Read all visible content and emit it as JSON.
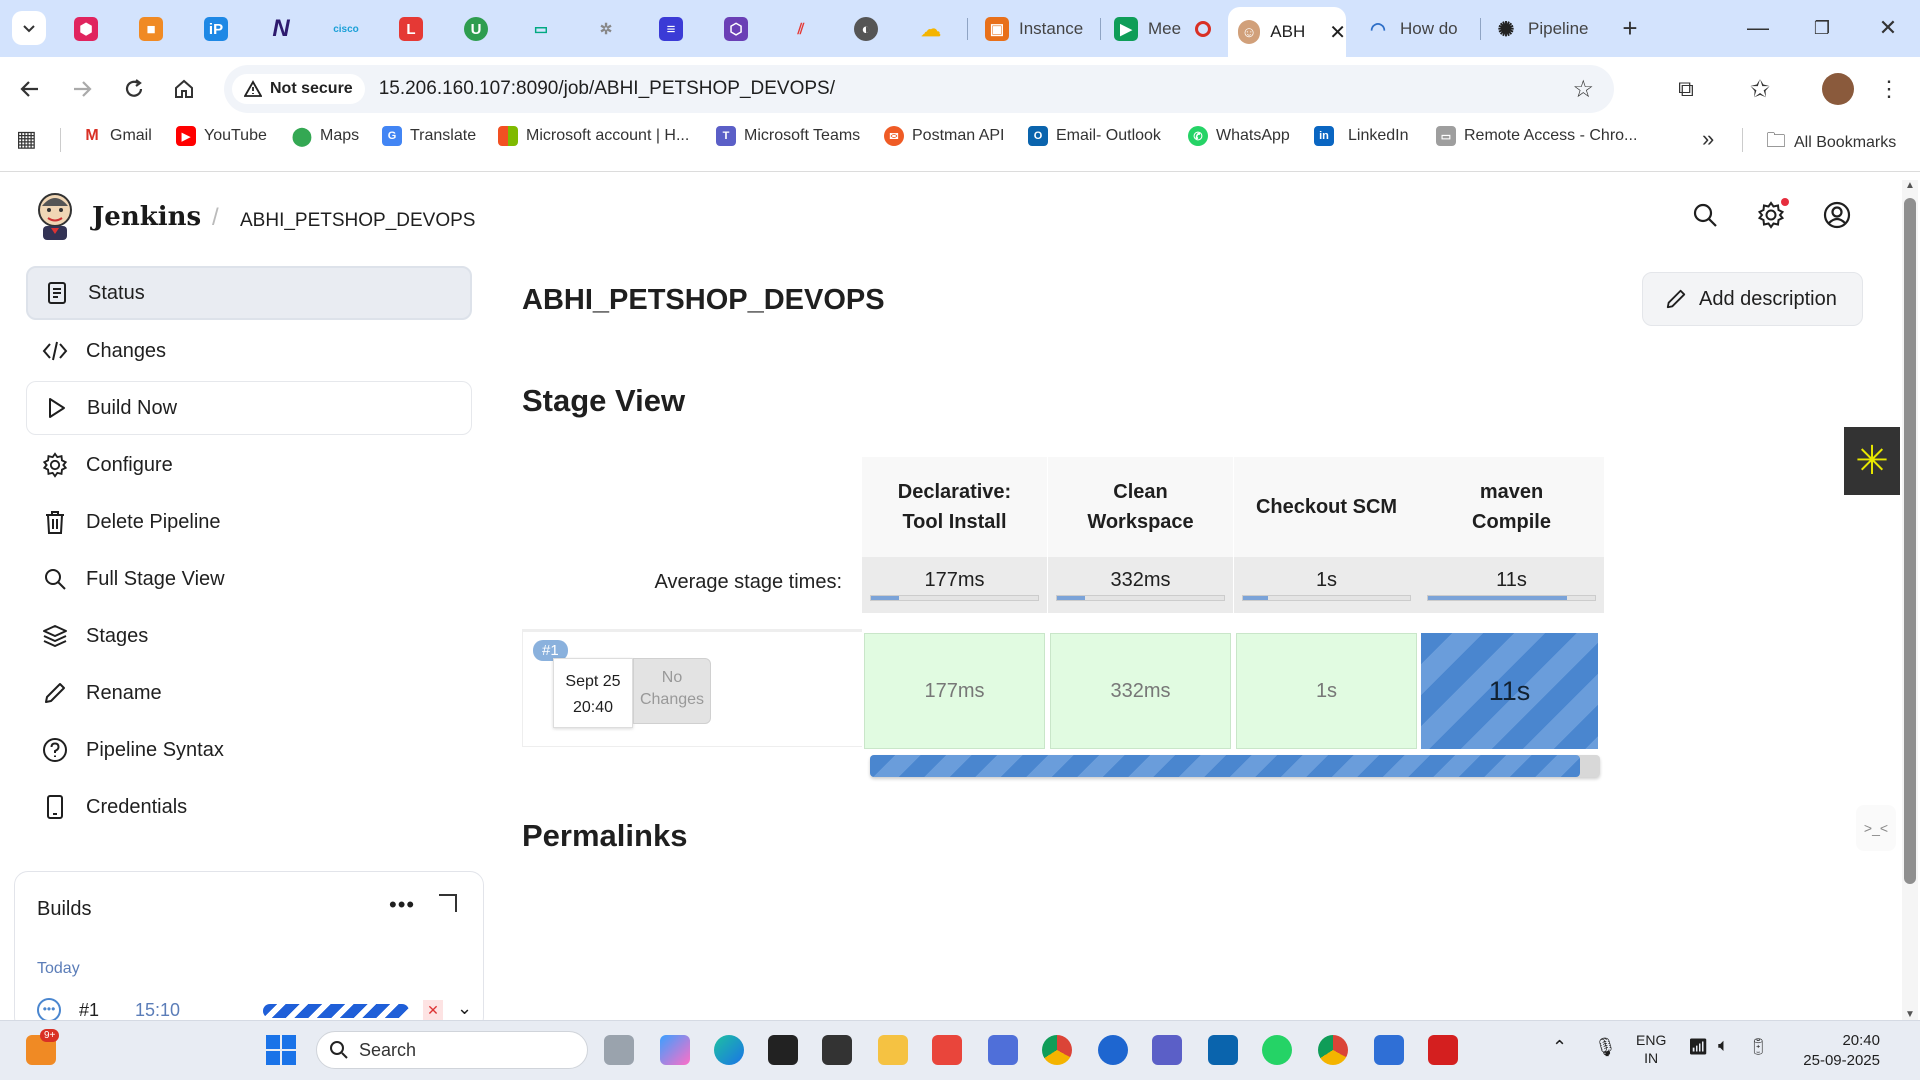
{
  "browser": {
    "tabs": [
      {
        "label": "Instance",
        "icon": "aws-icon"
      },
      {
        "label": "Mee",
        "icon": "meet-icon"
      },
      {
        "label": "ABH",
        "icon": "jenkins-icon"
      },
      {
        "label": "How do",
        "icon": "perplexity-icon"
      },
      {
        "label": "Pipeline",
        "icon": "chatgpt-icon"
      }
    ],
    "security_label": "Not secure",
    "url": "15.206.160.107:8090/job/ABHI_PETSHOP_DEVOPS/",
    "bookmarks": [
      "Gmail",
      "YouTube",
      "Maps",
      "Translate",
      "Microsoft account | H...",
      "Microsoft Teams",
      "Postman API",
      "Email- Outlook",
      "WhatsApp",
      "LinkedIn",
      "Remote Access - Chro..."
    ],
    "all_bookmarks": "All Bookmarks"
  },
  "jenkins": {
    "brand": "Jenkins",
    "breadcrumb": "ABHI_PETSHOP_DEVOPS",
    "sidebar": [
      {
        "label": "Status",
        "icon": "document-icon"
      },
      {
        "label": "Changes",
        "icon": "code-icon"
      },
      {
        "label": "Build Now",
        "icon": "play-icon"
      },
      {
        "label": "Configure",
        "icon": "gear-icon"
      },
      {
        "label": "Delete Pipeline",
        "icon": "trash-icon"
      },
      {
        "label": "Full Stage View",
        "icon": "search-icon"
      },
      {
        "label": "Stages",
        "icon": "layers-icon"
      },
      {
        "label": "Rename",
        "icon": "pencil-icon"
      },
      {
        "label": "Pipeline Syntax",
        "icon": "help-icon"
      },
      {
        "label": "Credentials",
        "icon": "phone-icon"
      }
    ],
    "builds": {
      "title": "Builds",
      "group": "Today",
      "items": [
        {
          "number": "#1",
          "time": "15:10"
        }
      ]
    },
    "title": "ABHI_PETSHOP_DEVOPS",
    "add_description": "Add description",
    "stage_view_title": "Stage View",
    "permalinks_title": "Permalinks",
    "stage_view": {
      "avg_label": "Average stage times:",
      "stages": [
        {
          "name_line1": "Declarative:",
          "name_line2": "Tool Install",
          "avg": "177ms",
          "avg_fraction": 0.17,
          "run": "177ms",
          "state": "success"
        },
        {
          "name_line1": "Clean",
          "name_line2": "Workspace",
          "avg": "332ms",
          "avg_fraction": 0.17,
          "run": "332ms",
          "state": "success"
        },
        {
          "name_line1": "Checkout SCM",
          "name_line2": "",
          "avg": "1s",
          "avg_fraction": 0.15,
          "run": "1s",
          "state": "success"
        },
        {
          "name_line1": "maven",
          "name_line2": "Compile",
          "avg": "11s",
          "avg_fraction": 0.83,
          "run": "11s",
          "state": "running"
        }
      ],
      "build": {
        "number": "#1",
        "date": "Sept 25",
        "time": "20:40",
        "changes": "No Changes"
      }
    }
  },
  "taskbar": {
    "badge": "9+",
    "search": "Search",
    "lang1": "ENG",
    "lang2": "IN",
    "time": "20:40",
    "date": "25-09-2025"
  },
  "colors": {
    "tabbar": "#d3e3fd",
    "success": "#e1fbe1",
    "running": "#4a86cf",
    "selected": "#e9ecf2"
  }
}
